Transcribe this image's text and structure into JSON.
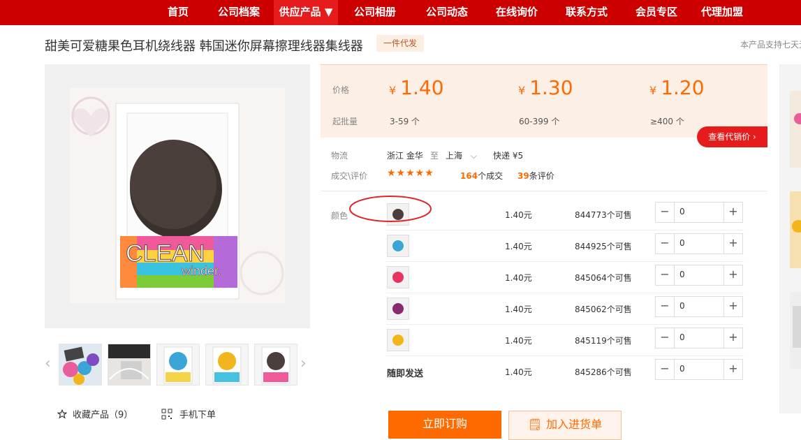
{
  "nav": {
    "items": [
      "首页",
      "公司档案",
      "供应产品 ▼",
      "公司相册",
      "公司动态",
      "在线询价",
      "联系方式",
      "会员专区",
      "代理加盟"
    ],
    "active_index": 2
  },
  "product": {
    "title": "甜美可爱糖果色耳机绕线器 韩国迷你屏幕擦理线器集线器",
    "tag": "一件代发",
    "note": "本产品支持七天无",
    "image_text": {
      "line1": "CLEAN",
      "line2": "winder."
    }
  },
  "gallery": {
    "prev_icon": "‹",
    "next_icon": "›",
    "thumb_colors": [
      "#e85e9a",
      "#555555",
      "#3aa6d8",
      "#f2b51c",
      "#4a3f3a"
    ]
  },
  "actions": {
    "favorite": "收藏产品（9）",
    "mobile_order": "手机下单"
  },
  "pricing": {
    "price_label": "价格",
    "min_qty_label": "起批量",
    "tiers": [
      {
        "yen": "¥",
        "price": "1.40",
        "range": "3-59 个"
      },
      {
        "yen": "¥",
        "price": "1.30",
        "range": "60-399 个"
      },
      {
        "yen": "¥",
        "price": "1.20",
        "range": "≥400 个"
      }
    ],
    "agent_price_button": "查看代销价 ›"
  },
  "logistics": {
    "label": "物流",
    "from": "浙江 金华",
    "to_word": "至",
    "to": "上海",
    "shipping": "快递 ¥5"
  },
  "reviews": {
    "label": "成交\\评价",
    "stars": "★★★★★",
    "deals_count": "164",
    "deals_label": "个成交",
    "review_count": "39",
    "review_label": "条评价"
  },
  "variants": {
    "label": "颜色",
    "rows": [
      {
        "color": "#4a3f3a",
        "price": "1.40元",
        "stock": "844773个可售",
        "qty": "0"
      },
      {
        "color": "#3aa6d8",
        "price": "1.40元",
        "stock": "844925个可售",
        "qty": "0"
      },
      {
        "color": "#e8335e",
        "price": "1.40元",
        "stock": "845064个可售",
        "qty": "0"
      },
      {
        "color": "#8a2a6e",
        "price": "1.40元",
        "stock": "845062个可售",
        "qty": "0"
      },
      {
        "color": "#f2b51c",
        "price": "1.40元",
        "stock": "845119个可售",
        "qty": "0"
      }
    ],
    "random_row": {
      "label": "随即发送",
      "price": "1.40元",
      "stock": "845286个可售",
      "qty": "0"
    },
    "minus_icon": "−",
    "plus_icon": "+"
  },
  "buttons": {
    "buy_now": "立即订购",
    "add_to_cart": "加入进货单"
  },
  "colors": {
    "nav_bg": "#cc0000",
    "accent": "#ff6a00",
    "annotation": "#e0262b"
  }
}
